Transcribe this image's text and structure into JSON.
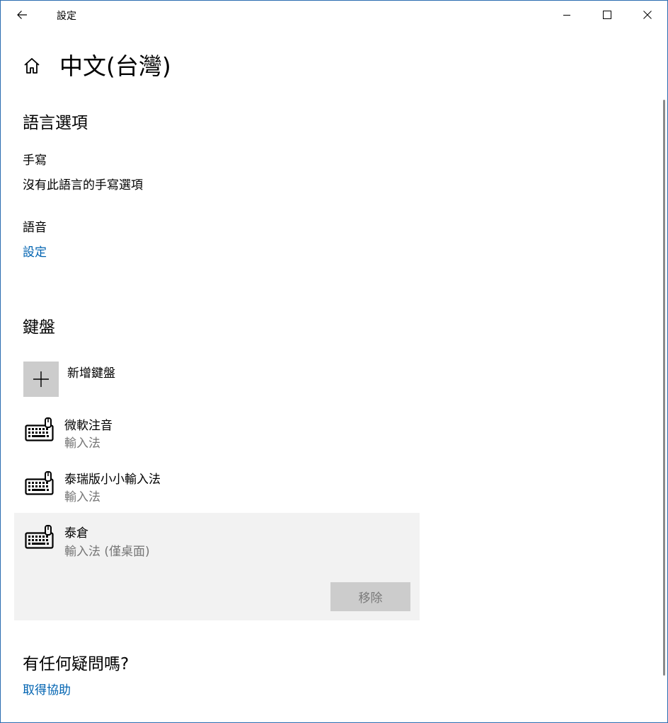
{
  "window": {
    "title": "設定",
    "controls": [
      "minimize-icon",
      "maximize-icon",
      "close-icon"
    ]
  },
  "header": {
    "page_title": "中文(台灣)",
    "home_icon": "home-icon",
    "back_icon": "back-arrow-icon"
  },
  "language_options": {
    "section_title": "語言選項",
    "handwriting": {
      "label": "手寫",
      "value": "沒有此語言的手寫選項"
    },
    "speech": {
      "label": "語音",
      "link": "設定"
    }
  },
  "keyboards": {
    "section_title": "鍵盤",
    "add_label": "新增鍵盤",
    "items": [
      {
        "name": "微軟注音",
        "type": "輸入法"
      },
      {
        "name": "泰瑞版小小輸入法",
        "type": "輸入法"
      },
      {
        "name": "泰倉",
        "type": "輸入法 (僅桌面)",
        "selected": true
      }
    ],
    "remove_label": "移除"
  },
  "help": {
    "section_title": "有任何疑問嗎?",
    "link": "取得協助"
  },
  "colors": {
    "accent_link": "#0063b1",
    "selected_bg": "#f2f2f2",
    "tile_bg": "#cccccc"
  }
}
